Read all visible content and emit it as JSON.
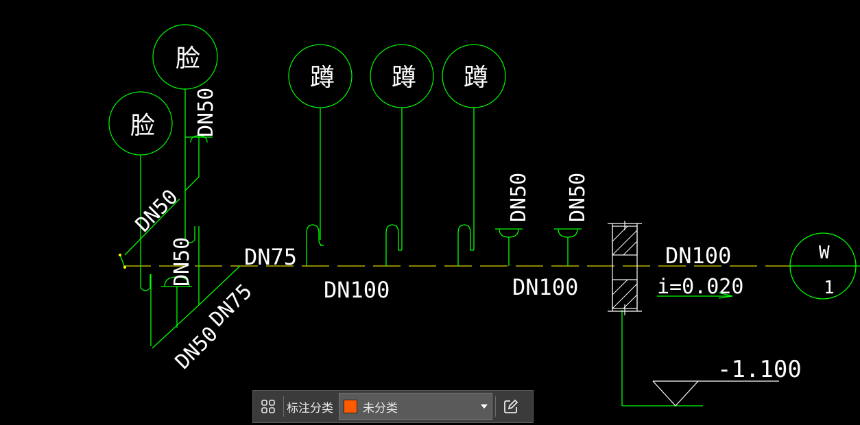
{
  "drawing": {
    "fixtures": {
      "washbasin_1": "脸",
      "washbasin_2": "脸",
      "squat_1": "蹲",
      "squat_2": "蹲",
      "squat_3": "蹲"
    },
    "labels": {
      "dn50_diag": "DN50",
      "dn50_vert_top": "DN50",
      "dn50_left_riser": "DN50",
      "dn75_main": "DN75",
      "dn75_branch": "DN75",
      "dn50_branch": "DN50",
      "dn100_a": "DN100",
      "dn100_b": "DN100",
      "dn50_floor_1": "DN50",
      "dn50_floor_2": "DN50",
      "dn100_outlet": "DN100",
      "slope": "i=0.020",
      "elevation": "-1.100"
    },
    "outlet_marker": {
      "letter": "W",
      "number": "1"
    },
    "colors": {
      "pipe": "#00ff00",
      "axis": "#ffff00",
      "text": "#ffffff",
      "background": "#000000"
    }
  },
  "toolbar": {
    "grid_icon": "grid-icon",
    "category_label": "标注分类",
    "selected_category": "未分类",
    "swatch_color": "#ff5a00",
    "edit_icon": "edit-icon"
  }
}
